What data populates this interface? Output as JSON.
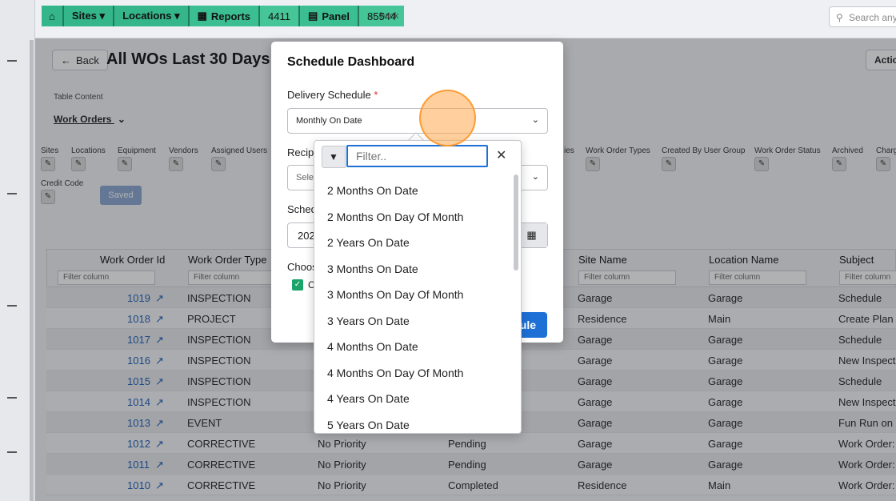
{
  "topbar": {
    "crumbs": [
      {
        "name": "home",
        "label": ""
      },
      {
        "name": "sites",
        "label": "Sites ▾"
      },
      {
        "name": "locations",
        "label": "Locations ▾"
      },
      {
        "name": "reports",
        "label": "Reports"
      },
      {
        "name": "reports-id",
        "label": "4411"
      },
      {
        "name": "panel",
        "label": "Panel"
      },
      {
        "name": "panel-id",
        "label": "85544"
      }
    ],
    "back_link": "← back",
    "search_placeholder": "Search any"
  },
  "page": {
    "back_label": "Back",
    "title": "All WOs Last 30 Days",
    "actions_label": "Actio",
    "table_content_label": "Table Content",
    "table_content_value": "Work Orders",
    "filters": [
      "Sites",
      "Locations",
      "Equipment",
      "Vendors",
      "Assigned Users",
      "ies",
      "Work Order Types",
      "Created By User Group",
      "Work Order Status",
      "Archived",
      "Charg"
    ],
    "credit_code": "Credit Code",
    "saved_label": "Saved"
  },
  "table": {
    "headers": [
      "Work Order Id",
      "Work Order Type",
      "",
      "",
      "Site Name",
      "Location Name",
      "Subject"
    ],
    "filter_placeholder": "Filter column",
    "rows": [
      [
        "1019",
        "INSPECTION",
        "",
        "",
        "Garage",
        "Garage",
        "Schedule"
      ],
      [
        "1018",
        "PROJECT",
        "",
        "",
        "Residence",
        "Main",
        "Create Plan"
      ],
      [
        "1017",
        "INSPECTION",
        "",
        "",
        "Garage",
        "Garage",
        "Schedule"
      ],
      [
        "1016",
        "INSPECTION",
        "",
        "",
        "Garage",
        "Garage",
        "New Inspect"
      ],
      [
        "1015",
        "INSPECTION",
        "",
        "",
        "Garage",
        "Garage",
        "Schedule"
      ],
      [
        "1014",
        "INSPECTION",
        "",
        "",
        "Garage",
        "Garage",
        "New Inspect"
      ],
      [
        "1013",
        "EVENT",
        "",
        "",
        "Garage",
        "Garage",
        "Fun Run on C"
      ],
      [
        "1012",
        "CORRECTIVE",
        "No Priority",
        "Pending",
        "Garage",
        "Garage",
        "Work Order:"
      ],
      [
        "1011",
        "CORRECTIVE",
        "No Priority",
        "Pending",
        "Garage",
        "Garage",
        "Work Order:"
      ],
      [
        "1010",
        "CORRECTIVE",
        "No Priority",
        "Completed",
        "Residence",
        "Main",
        "Work Order:"
      ]
    ]
  },
  "modal": {
    "title": "Schedule Dashboard",
    "delivery_label": "Delivery Schedule",
    "required_mark": "*",
    "delivery_value": "Monthly On Date",
    "recip_label": "Recip",
    "recip_placeholder": "Sele",
    "sched_label": "Sched",
    "date_value": "202",
    "choose_label": "Choos",
    "check_label": "C",
    "schedule_btn": "ule"
  },
  "dropdown": {
    "filter_placeholder": "Filter..",
    "options": [
      "2 Months On Date",
      "2 Months On Day Of Month",
      "2 Years On Date",
      "3 Months On Date",
      "3 Months On Day Of Month",
      "3 Years On Date",
      "4 Months On Date",
      "4 Months On Day Of Month",
      "4 Years On Date",
      "5 Years On Date"
    ]
  },
  "colors": {
    "accent": "#1e70d6",
    "breadcrumb": "#34b58a",
    "link": "#1d5fb6"
  }
}
